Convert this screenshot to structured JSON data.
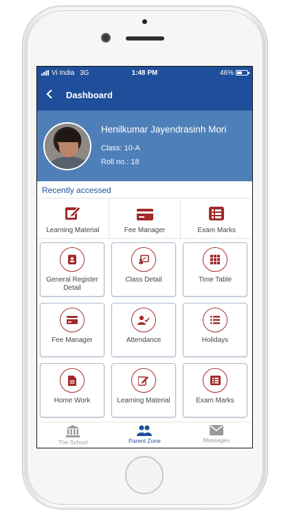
{
  "status": {
    "carrier": "Vi India",
    "network": "3G",
    "time": "1:48 PM",
    "battery": "46%"
  },
  "appbar": {
    "title": "Dashboard"
  },
  "profile": {
    "name": "Henilkumar Jayendrasinh Mori",
    "class_text": "Class: 10-A",
    "roll_text": "Roll no.: 18"
  },
  "recent": {
    "title": "Recently accessed",
    "items": [
      {
        "label": "Learning Material",
        "icon": "edit-icon"
      },
      {
        "label": "Fee Manager",
        "icon": "card-icon"
      },
      {
        "label": "Exam Marks",
        "icon": "list-icon"
      }
    ]
  },
  "tiles": [
    {
      "label": "General Register Detail",
      "icon": "register-icon"
    },
    {
      "label": "Class Detail",
      "icon": "class-icon"
    },
    {
      "label": "Time Table",
      "icon": "grid-icon"
    },
    {
      "label": "Fee Manager",
      "icon": "card-icon"
    },
    {
      "label": "Attendance",
      "icon": "user-check-icon"
    },
    {
      "label": "Holidays",
      "icon": "list-icon"
    },
    {
      "label": "Home Work",
      "icon": "document-icon"
    },
    {
      "label": "Learning Material",
      "icon": "edit-icon"
    },
    {
      "label": "Exam Marks",
      "icon": "list-icon"
    }
  ],
  "nav": [
    {
      "label": "The School",
      "icon": "bank-icon"
    },
    {
      "label": "Parent Zone",
      "icon": "users-icon"
    },
    {
      "label": "Messages",
      "icon": "envelope-icon"
    }
  ],
  "colors": {
    "primary": "#1f4f9a",
    "profile_bg": "#4f7fb8",
    "accent": "#a12b2b"
  }
}
